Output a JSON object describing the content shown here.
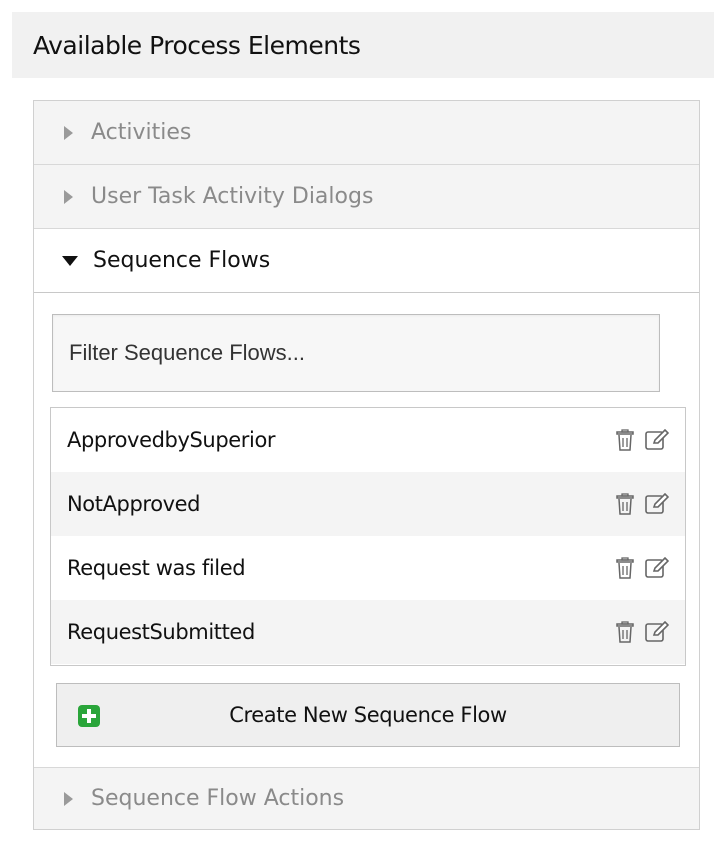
{
  "header": {
    "title": "Available Process Elements"
  },
  "sections": {
    "activities": {
      "label": "Activities"
    },
    "user_task_dialogs": {
      "label": "User Task Activity Dialogs"
    },
    "sequence_flows": {
      "label": "Sequence Flows",
      "filter_placeholder": "Filter Sequence Flows...",
      "items": [
        {
          "label": "ApprovedbySuperior"
        },
        {
          "label": "NotApproved"
        },
        {
          "label": "Request was filed"
        },
        {
          "label": "RequestSubmitted"
        }
      ],
      "create_label": "Create New Sequence Flow"
    },
    "sequence_flow_actions": {
      "label": "Sequence Flow Actions"
    }
  },
  "icons": {
    "delete": "trash-icon",
    "edit": "edit-icon",
    "add": "plus-icon"
  },
  "colors": {
    "add_icon": "#2aa53a",
    "collapsed_text": "#8a8a8a"
  }
}
